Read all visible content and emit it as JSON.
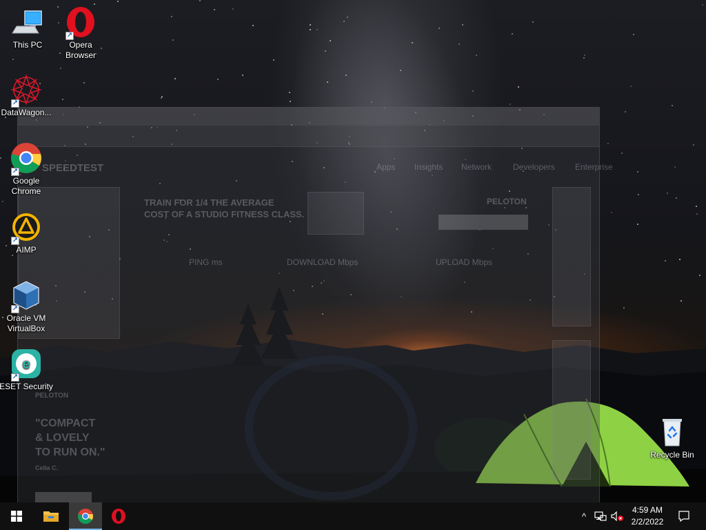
{
  "desktop": {
    "icons": [
      {
        "label": "This PC",
        "icon": "computer-icon"
      },
      {
        "label": "Opera Browser",
        "icon": "opera-icon"
      },
      {
        "label": "DataWagon...",
        "icon": "datawagon-icon"
      },
      {
        "label": "Google Chrome",
        "icon": "chrome-icon"
      },
      {
        "label": "AIMP",
        "icon": "aimp-icon"
      },
      {
        "label": "Oracle VM VirtualBox",
        "icon": "virtualbox-icon"
      },
      {
        "label": "ESET Security",
        "icon": "eset-icon"
      },
      {
        "label": "Recycle Bin",
        "icon": "recycle-bin-icon"
      }
    ]
  },
  "ghost_window": {
    "brand": "SPEEDTEST",
    "nav": [
      "Apps",
      "Insights",
      "Network",
      "Developers",
      "Enterprise"
    ],
    "ad_headline_1": "TRAIN FOR 1/4 THE AVERAGE",
    "ad_headline_2": "COST OF A STUDIO FITNESS CLASS.",
    "ad_brand": "PELOTON",
    "metrics": [
      "PING ms",
      "DOWNLOAD Mbps",
      "UPLOAD Mbps"
    ],
    "side_brand": "PELOTON",
    "side_quote_1": "\"COMPACT",
    "side_quote_2": "& LOVELY",
    "side_quote_3": "TO RUN ON.\"",
    "side_author": "Celia C."
  },
  "taskbar": {
    "pinned": [
      "start-icon",
      "file-explorer-icon",
      "chrome-icon",
      "opera-icon"
    ],
    "active": "chrome-icon",
    "tray": {
      "chevron": "^",
      "time": "4:59 AM",
      "date": "2/2/2022"
    }
  },
  "colors": {
    "taskbar": "#101010",
    "active_indicator": "#76b9ed",
    "tent_green": "#9be34a"
  }
}
